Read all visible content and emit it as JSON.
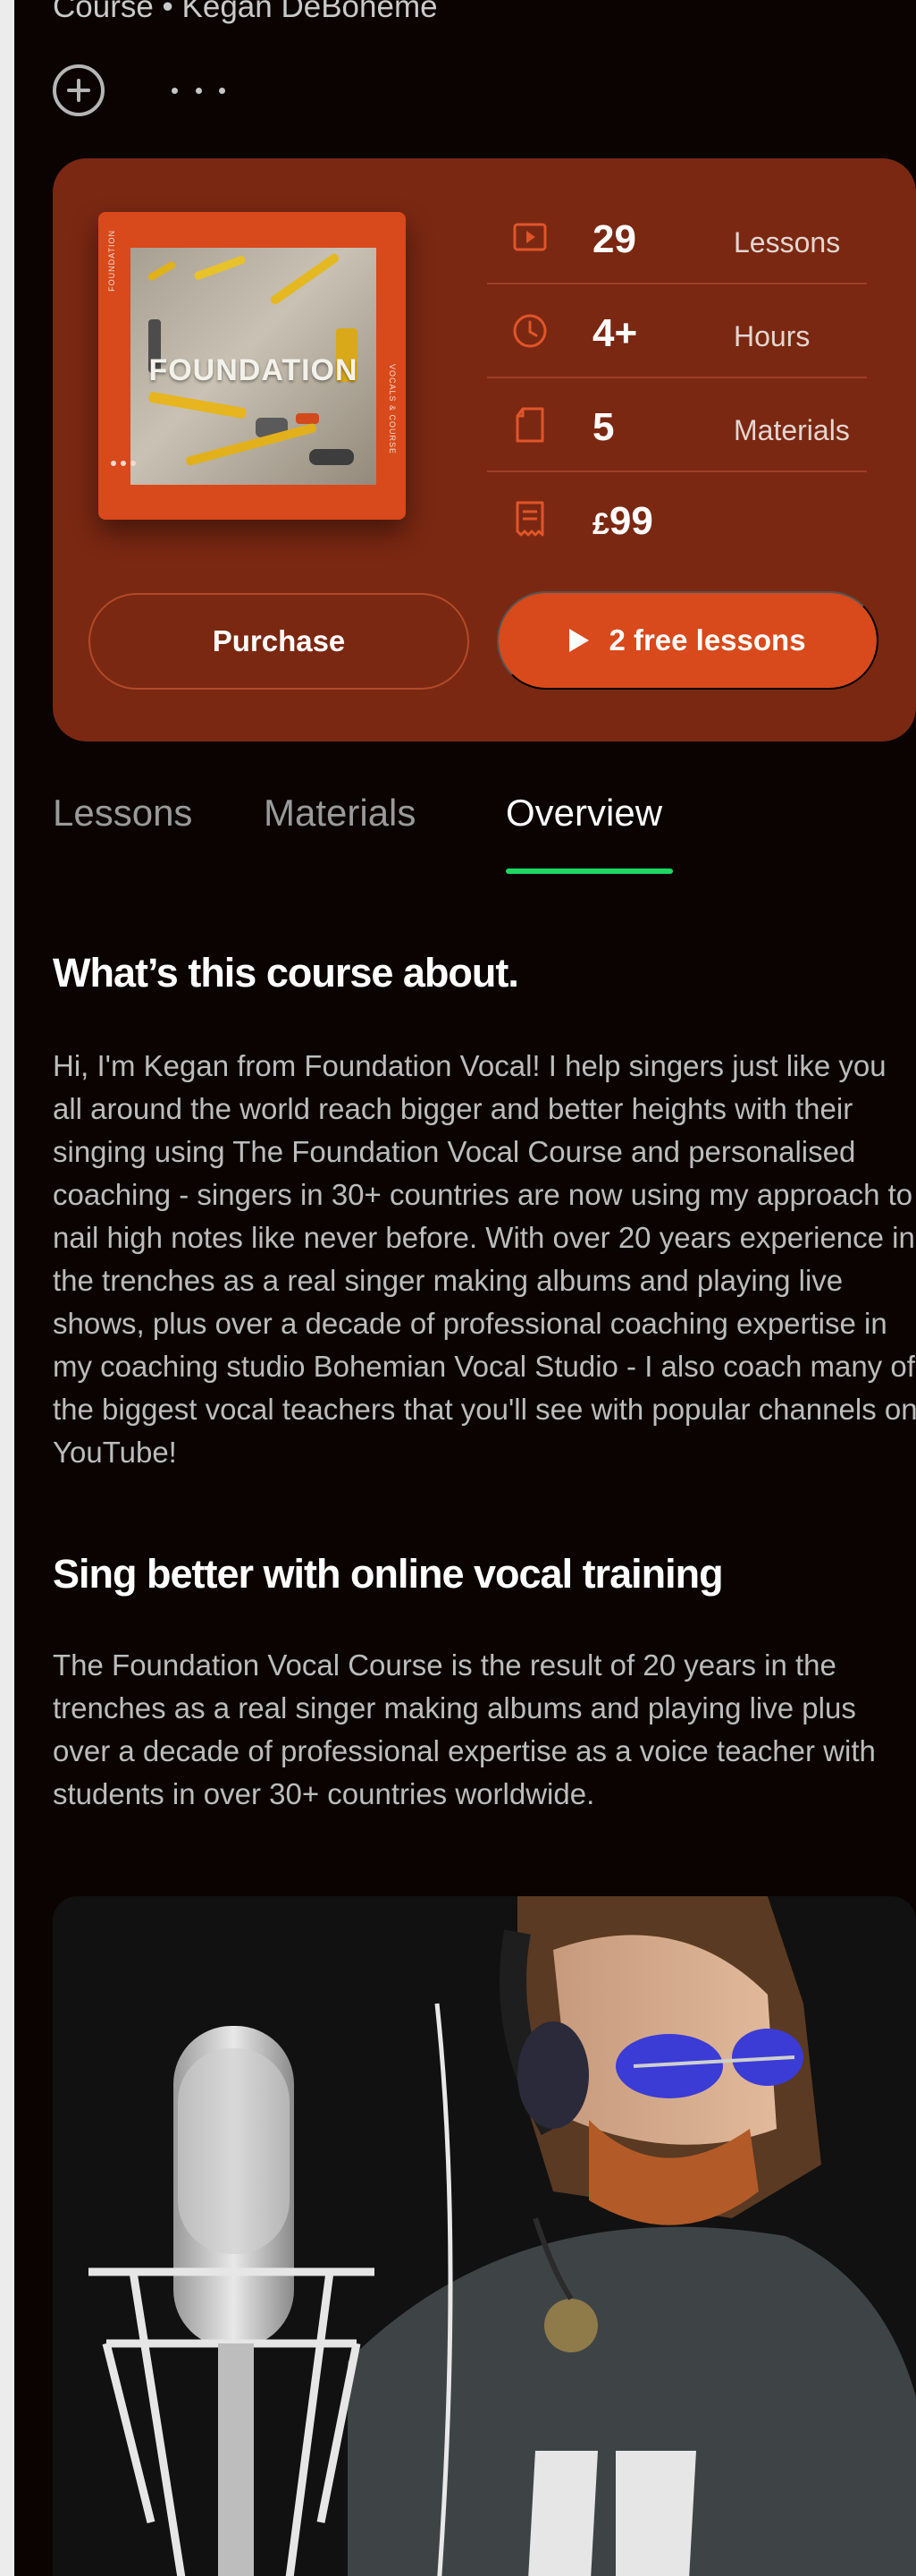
{
  "header": {
    "subtitle": "Course • Kegan DeBoheme"
  },
  "card": {
    "cover": {
      "title": "FOUNDATION",
      "side_text": "VOCALS & COURSE",
      "side_text_left": "FOUNDATION"
    },
    "stats": [
      {
        "icon": "play-lesson-icon",
        "value": "29",
        "label": "Lessons"
      },
      {
        "icon": "clock-icon",
        "value": "4+",
        "label": "Hours"
      },
      {
        "icon": "document-icon",
        "value": "5",
        "label": "Materials"
      },
      {
        "icon": "receipt-icon",
        "currency": "£",
        "value": "99",
        "label": ""
      }
    ],
    "purchase_label": "Purchase",
    "free_lessons_label": "2 free lessons"
  },
  "tabs": [
    {
      "label": "Lessons",
      "active": false
    },
    {
      "label": "Materials",
      "active": false
    },
    {
      "label": "Overview",
      "active": true
    }
  ],
  "overview": {
    "heading1": "What’s this course about.",
    "para1": "Hi, I'm Kegan from Foundation Vocal! I help singers just like you all around the world reach bigger and better heights with their singing using The Foundation Vocal Course and personalised coaching - singers in 30+ countries are now using my approach to nail high notes like never before. With over 20 years experience in the trenches as a real singer making albums and playing live shows, plus over a decade of professional coaching expertise in my coaching studio Bohemian Vocal Studio - I also coach many of the biggest vocal teachers that you'll see with popular channels on YouTube!",
    "heading2": "Sing better with online vocal training",
    "para2": "The Foundation Vocal Course is the result of 20 years in the trenches as a real singer making albums and playing live plus over a decade of professional expertise as a voice teacher with students in over 30+ countries worldwide.",
    "shirt_text": "DEAD"
  },
  "colors": {
    "background": "#0a0302",
    "card": "#7a2812",
    "accent": "#d8491c",
    "tab_indicator": "#1ed760"
  }
}
